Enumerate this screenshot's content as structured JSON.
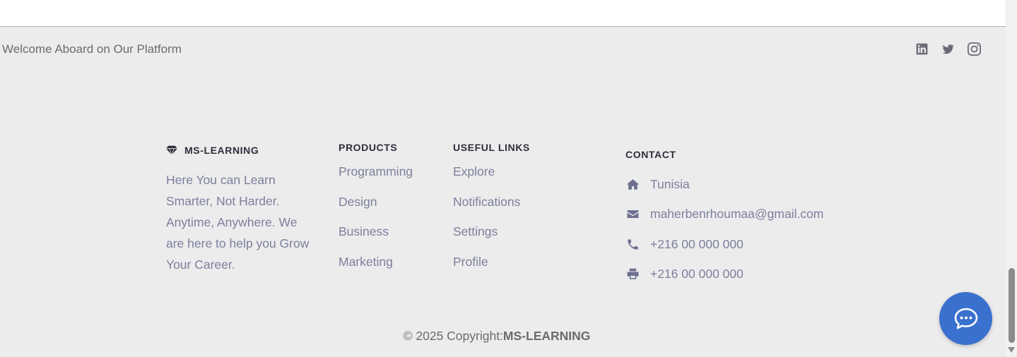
{
  "top_bar": {
    "welcome_text": "Welcome Aboard on Our Platform",
    "social_icons": [
      "linkedin-icon",
      "twitter-icon",
      "instagram-icon"
    ]
  },
  "brand": {
    "name": "MS-LEARNING",
    "icon": "gem-icon",
    "description": "Here You can Learn Smarter, Not Harder. Anytime, Anywhere. We are here to help you Grow Your Career."
  },
  "products": {
    "title": "PRODUCTS",
    "items": [
      "Programming",
      "Design",
      "Business",
      "Marketing"
    ]
  },
  "useful_links": {
    "title": "USEFUL LINKS",
    "items": [
      "Explore",
      "Notifications",
      "Settings",
      "Profile"
    ]
  },
  "contact": {
    "title": "CONTACT",
    "items": [
      {
        "icon": "home-icon",
        "text": "Tunisia"
      },
      {
        "icon": "envelope-icon",
        "text": "maherbenrhoumaa@gmail.com"
      },
      {
        "icon": "phone-icon",
        "text": "+216 00 000 000"
      },
      {
        "icon": "printer-icon",
        "text": "+216 00 000 000"
      }
    ]
  },
  "footer": {
    "copyright_prefix": "© 2025 Copyright:",
    "copyright_brand": "MS-LEARNING"
  },
  "chat": {
    "icon": "chat-bubble-icon"
  },
  "colors": {
    "background": "#ececec",
    "text_muted": "#7d7f9e",
    "heading": "#2e2e3c",
    "chat_button": "#3a71cf"
  }
}
